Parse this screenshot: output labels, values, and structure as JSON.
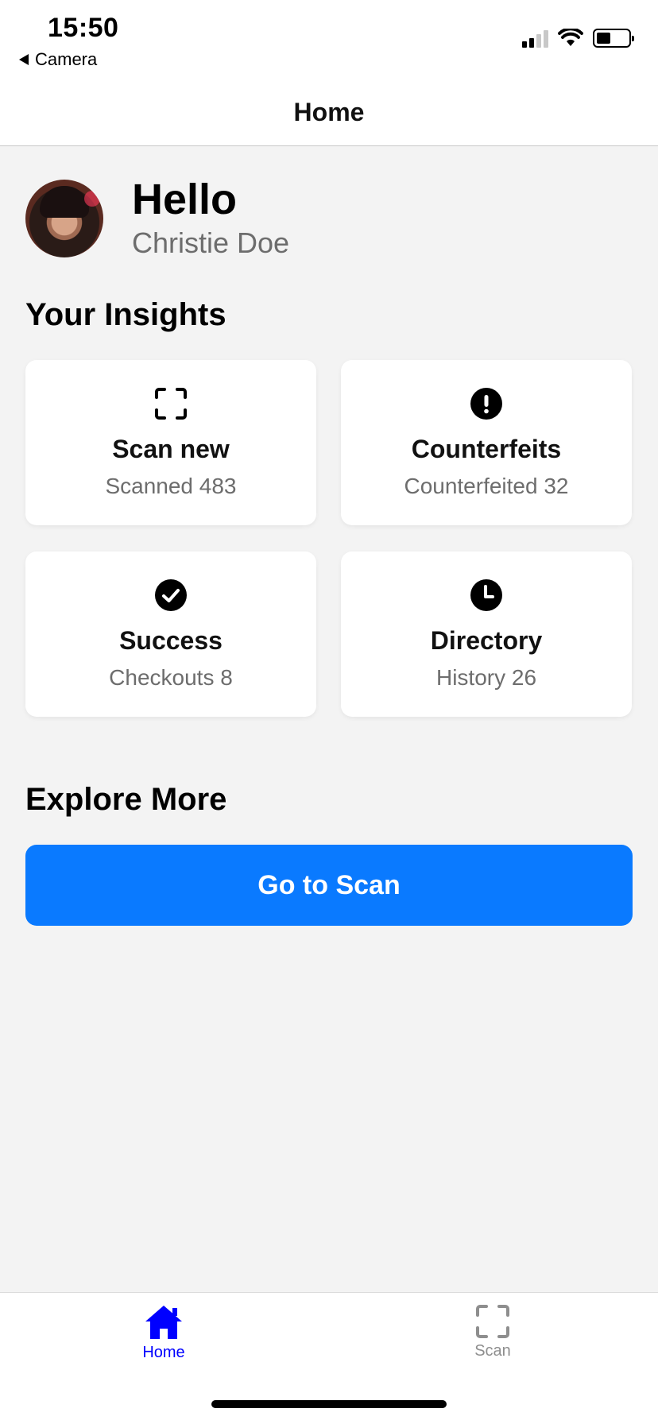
{
  "status_bar": {
    "time": "15:50",
    "back_app": "Camera",
    "icons": [
      "signal-icon",
      "wifi-icon",
      "battery-icon"
    ]
  },
  "header": {
    "title": "Home"
  },
  "greeting": {
    "hello": "Hello",
    "name": "Christie Doe"
  },
  "insights": {
    "title": "Your Insights",
    "cards": [
      {
        "icon": "scan-frame-icon",
        "title": "Scan new",
        "subtitle": "Scanned 483"
      },
      {
        "icon": "exclamation-circle-icon",
        "title": "Counterfeits",
        "subtitle": "Counterfeited 32"
      },
      {
        "icon": "checkmark-circle-icon",
        "title": "Success",
        "subtitle": "Checkouts 8"
      },
      {
        "icon": "clock-icon",
        "title": "Directory",
        "subtitle": "History 26"
      }
    ]
  },
  "explore": {
    "title": "Explore More",
    "button_label": "Go to Scan"
  },
  "tab_bar": {
    "items": [
      {
        "label": "Home",
        "icon": "home-icon",
        "active": true
      },
      {
        "label": "Scan",
        "icon": "scan-frame-icon",
        "active": false
      }
    ]
  },
  "colors": {
    "accent": "#0a7aff",
    "tab_active": "#0000ff",
    "tab_inactive": "#8e8e8e",
    "background": "#f3f3f3"
  }
}
